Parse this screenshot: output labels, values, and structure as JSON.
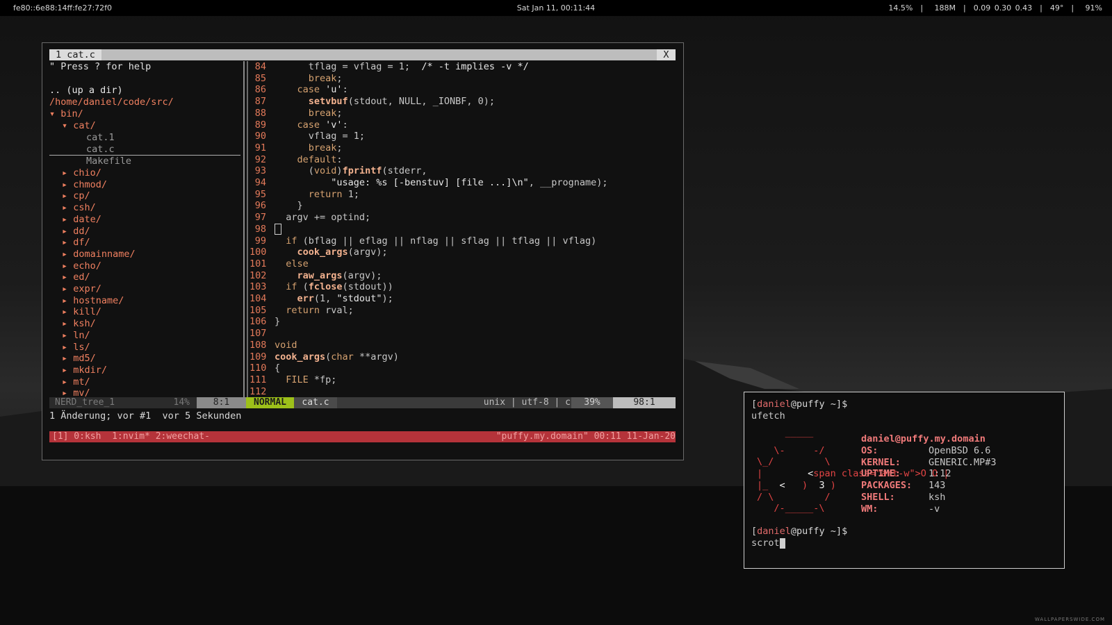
{
  "topbar": {
    "ip": "fe80::6e88:14ff:fe27:72f0",
    "datetime": "Sat Jan 11, 00:11:44",
    "stats": "14.5%  |   188M  |  0.09 0.30 0.43  |  49°  |   91%"
  },
  "editor": {
    "tab_label": "1 cat.c",
    "close_label": "X",
    "nerdtree": {
      "help": "\" Press ? for help",
      "up_dir": ".. (up a dir)",
      "path": "/home/daniel/code/src/",
      "bin_dir": "bin/",
      "cat_dir": "cat/",
      "cat_files": [
        "cat.1",
        "cat.c",
        "Makefile"
      ],
      "dirs": [
        "chio/",
        "chmod/",
        "cp/",
        "csh/",
        "date/",
        "dd/",
        "df/",
        "domainname/",
        "echo/",
        "ed/",
        "expr/",
        "hostname/",
        "kill/",
        "ksh/",
        "ln/",
        "ls/",
        "md5/",
        "mkdir/",
        "mt/",
        "mv/"
      ]
    },
    "code_lines": [
      {
        "n": "84",
        "t": "      tflag = vflag = 1;  /* -t implies -v */"
      },
      {
        "n": "85",
        "t": "      break;"
      },
      {
        "n": "86",
        "t": "    case 'u':"
      },
      {
        "n": "87",
        "t": "      setvbuf(stdout, NULL, _IONBF, 0);"
      },
      {
        "n": "88",
        "t": "      break;"
      },
      {
        "n": "89",
        "t": "    case 'v':"
      },
      {
        "n": "90",
        "t": "      vflag = 1;"
      },
      {
        "n": "91",
        "t": "      break;"
      },
      {
        "n": "92",
        "t": "    default:"
      },
      {
        "n": "93",
        "t": "      (void)fprintf(stderr,"
      },
      {
        "n": "94",
        "t": "          \"usage: %s [-benstuv] [file ...]\\n\", __progname);"
      },
      {
        "n": "95",
        "t": "      return 1;"
      },
      {
        "n": "96",
        "t": "    }"
      },
      {
        "n": "97",
        "t": "  argv += optind;"
      },
      {
        "n": "98",
        "t": ""
      },
      {
        "n": "99",
        "t": "  if (bflag || eflag || nflag || sflag || tflag || vflag)"
      },
      {
        "n": "100",
        "t": "    cook_args(argv);"
      },
      {
        "n": "101",
        "t": "  else"
      },
      {
        "n": "102",
        "t": "    raw_args(argv);"
      },
      {
        "n": "103",
        "t": "  if (fclose(stdout))"
      },
      {
        "n": "104",
        "t": "    err(1, \"stdout\");"
      },
      {
        "n": "105",
        "t": "  return rval;"
      },
      {
        "n": "106",
        "t": "}"
      },
      {
        "n": "107",
        "t": ""
      },
      {
        "n": "108",
        "t": "void"
      },
      {
        "n": "109",
        "t": "cook_args(char **argv)"
      },
      {
        "n": "110",
        "t": "{"
      },
      {
        "n": "111",
        "t": "  FILE *fp;"
      },
      {
        "n": "112",
        "t": ""
      }
    ],
    "status": {
      "nerdtree_label": "NERD_tree_1",
      "nerdtree_pct": "14%",
      "nerdtree_pos": "8:1",
      "mode": "NORMAL",
      "file": "cat.c",
      "info": "unix | utf-8 | c",
      "pct": "39%",
      "pos": "98:1"
    },
    "message": "1 Änderung; vor #1  vor 5 Sekunden"
  },
  "tmux": {
    "left": "[1] 0:ksh  1:nvim* 2:weechat-",
    "right": "\"puffy.my.domain\" 00:11 11-Jan-20"
  },
  "fetch_terminal": {
    "prompt_open": "[",
    "prompt_user": "daniel",
    "prompt_host": "@puffy ~]$",
    "cmd1": "ufetch",
    "art": [
      "     _____",
      "   \\-     -/",
      "\\_/         \\",
      "|        O O |",
      "|_  <   )  3 )",
      "/ \\         /",
      "   /-_____-\\"
    ],
    "header_user": "daniel",
    "header_host": "@puffy.my.domain",
    "info": [
      {
        "k": "OS:",
        "v": "OpenBSD 6.6"
      },
      {
        "k": "KERNEL:",
        "v": "GENERIC.MP#3"
      },
      {
        "k": "UPTIME:",
        "v": "1:12"
      },
      {
        "k": "PACKAGES:",
        "v": "143"
      },
      {
        "k": "SHELL:",
        "v": "ksh"
      },
      {
        "k": "WM:",
        "v": "-v"
      }
    ],
    "cmd2": "scrot"
  },
  "watermark": "WALLPAPERSWIDE.COM"
}
